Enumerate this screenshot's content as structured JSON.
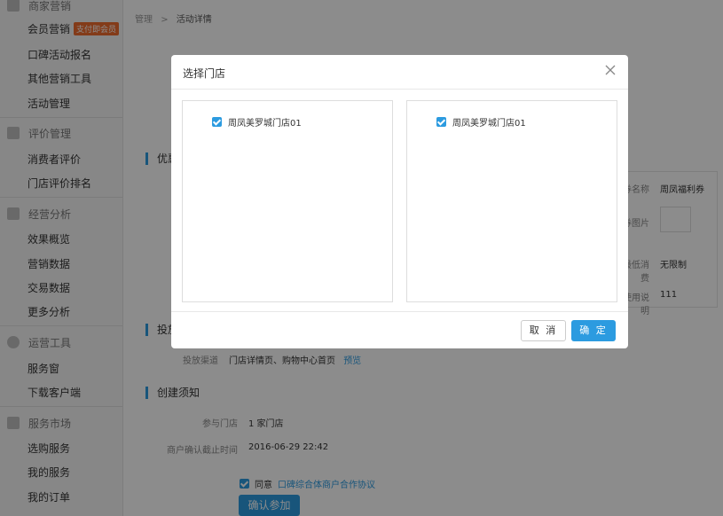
{
  "sidebar": {
    "sections": [
      {
        "title": "商家营销",
        "items": [
          "会员营销",
          "口碑活动报名",
          "其他营销工具",
          "活动管理"
        ],
        "badge": "支付即会员"
      },
      {
        "title": "评价管理",
        "items": [
          "消费者评价",
          "门店评价排名"
        ]
      },
      {
        "title": "经营分析",
        "items": [
          "效果概览",
          "营销数据",
          "交易数据",
          "更多分析"
        ]
      },
      {
        "title": "运营工具",
        "items": [
          "服务窗",
          "下载客户端"
        ]
      },
      {
        "title": "服务市场",
        "items": [
          "选购服务",
          "我的服务",
          "我的订单"
        ]
      }
    ]
  },
  "breadcrumb": {
    "parent": "管理",
    "sep": ">",
    "current": "活动详情"
  },
  "main": {
    "sections": {
      "youhui": "优惠",
      "toufang": "投放",
      "create": "创建须知"
    },
    "right_table": {
      "rows": [
        {
          "label": "券名称",
          "value": "周凤福利券"
        },
        {
          "label": "券图片",
          "value": ""
        },
        {
          "label": "最低消费",
          "value": "无限制"
        },
        {
          "label": "使用说明",
          "value": "111"
        }
      ]
    },
    "channel": {
      "label": "投放渠道",
      "value": "门店详情页、购物中心首页",
      "link": "预览"
    },
    "stores": {
      "label": "参与门店",
      "value": "1 家门店"
    },
    "deadline": {
      "label": "商户确认截止时间",
      "value": "2016-06-29 22:42"
    },
    "agree": {
      "text": "同意",
      "link": "口碑综合体商户合作协议"
    },
    "confirm_button": "确认参加"
  },
  "modal": {
    "title": "选择门店",
    "left_store": "周凤美罗城门店01",
    "right_store": "周凤美罗城门店01",
    "cancel": "取 消",
    "ok": "确 定"
  },
  "colors": {
    "accent": "#2c9be0",
    "badge": "#ef6c2f"
  }
}
